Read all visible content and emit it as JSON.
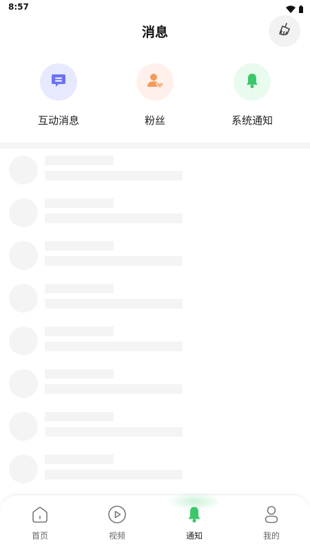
{
  "status_bar": {
    "time": "8:57"
  },
  "header": {
    "title": "消息",
    "clear_icon": "broom-icon"
  },
  "categories": [
    {
      "label": "互动消息",
      "icon": "chat-bubble-icon",
      "bg": "#e6e9ff",
      "color": "#6b72f5"
    },
    {
      "label": "粉丝",
      "icon": "user-heart-icon",
      "bg": "#fff0eb",
      "color": "#f59a5a"
    },
    {
      "label": "系统通知",
      "icon": "bell-icon",
      "bg": "#e8fbee",
      "color": "#3cc76c"
    }
  ],
  "tabbar": {
    "tabs": [
      {
        "label": "首页",
        "icon": "home-icon"
      },
      {
        "label": "视频",
        "icon": "play-circle-icon"
      },
      {
        "label": "通知",
        "icon": "bell-icon",
        "active": true
      },
      {
        "label": "我的",
        "icon": "profile-icon"
      }
    ],
    "active_color": "#3cc76c"
  }
}
